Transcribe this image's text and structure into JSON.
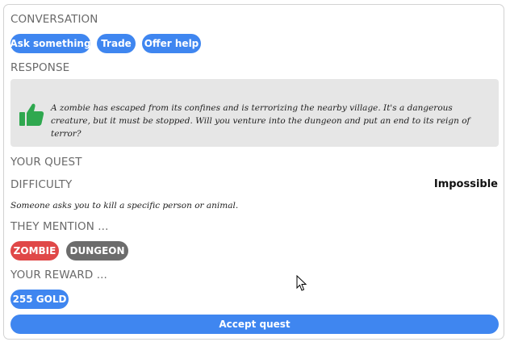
{
  "conversation": {
    "label": "CONVERSATION",
    "buttons": [
      "Ask something",
      "Trade",
      "Offer help"
    ]
  },
  "response": {
    "label": "RESPONSE",
    "icon": "thumbs-up-icon",
    "text": "A zombie has escaped from its confines and is terrorizing the nearby village. It's a dangerous creature, but it must be stopped. Will you venture into the dungeon and put an end to its reign of terror?"
  },
  "quest": {
    "label": "YOUR QUEST",
    "difficulty_label": "DIFFICULTY",
    "difficulty_value": "Impossible",
    "description": "Someone asks you to kill a specific person or animal."
  },
  "mentions": {
    "label": "THEY MENTION ...",
    "tags": [
      {
        "text": "ZOMBIE",
        "color": "#e04848"
      },
      {
        "text": "DUNGEON",
        "color": "#6c6c6c"
      }
    ]
  },
  "reward": {
    "label": "YOUR REWARD ...",
    "value": "255 GOLD"
  },
  "accept_button": "Accept quest",
  "colors": {
    "accent": "#3f86f0",
    "thumb": "#2fa84f"
  }
}
